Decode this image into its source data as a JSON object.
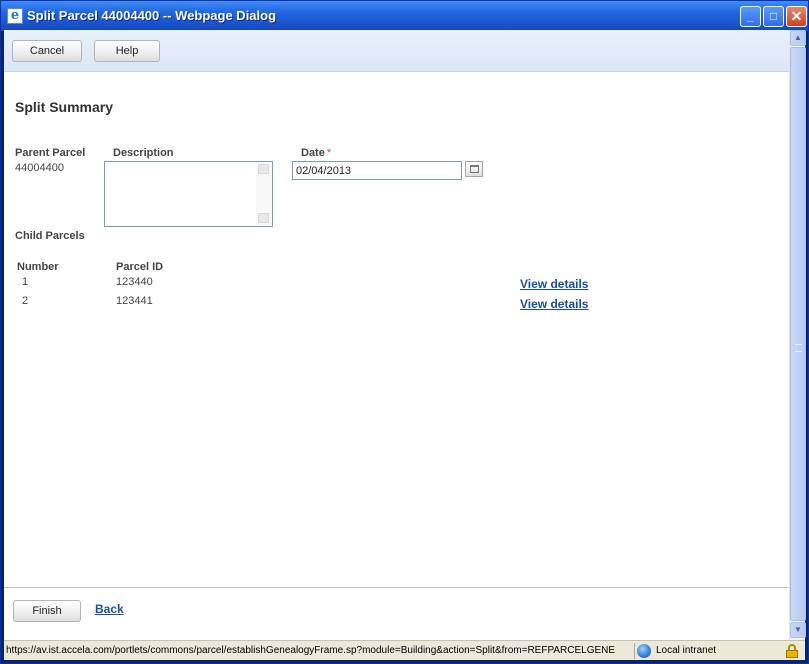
{
  "window": {
    "title": "Split Parcel 44004400 -- Webpage Dialog",
    "icon": "ie-page-icon",
    "buttons": [
      "minimize",
      "maximize",
      "close"
    ]
  },
  "toolbar": {
    "cancel_label": "Cancel",
    "help_label": "Help"
  },
  "page": {
    "heading": "Split Summary",
    "parent_parcel_label": "Parent Parcel",
    "parent_parcel_value": "44004400",
    "description_label": "Description",
    "description_value": "",
    "date_label": "Date",
    "date_required_mark": "*",
    "date_value": "02/04/2013",
    "child_parcels_label": "Child Parcels",
    "columns": {
      "number": "Number",
      "parcel_id": "Parcel ID"
    },
    "rows": [
      {
        "number": "1",
        "parcel_id": "123440",
        "link": "View details"
      },
      {
        "number": "2",
        "parcel_id": "123441",
        "link": "View details"
      }
    ]
  },
  "footer": {
    "finish_label": "Finish",
    "back_label": "Back"
  },
  "statusbar": {
    "url": "https://av.ist.accela.com/portlets/commons/parcel/establishGenealogyFrame.sp?module=Building&action=Split&from=REFPARCELGENE",
    "zone": "Local intranet"
  },
  "colors": {
    "titlebar": "#2468e0",
    "link": "#1a4e9a",
    "toolbar_bg": "#dbe7f6"
  }
}
